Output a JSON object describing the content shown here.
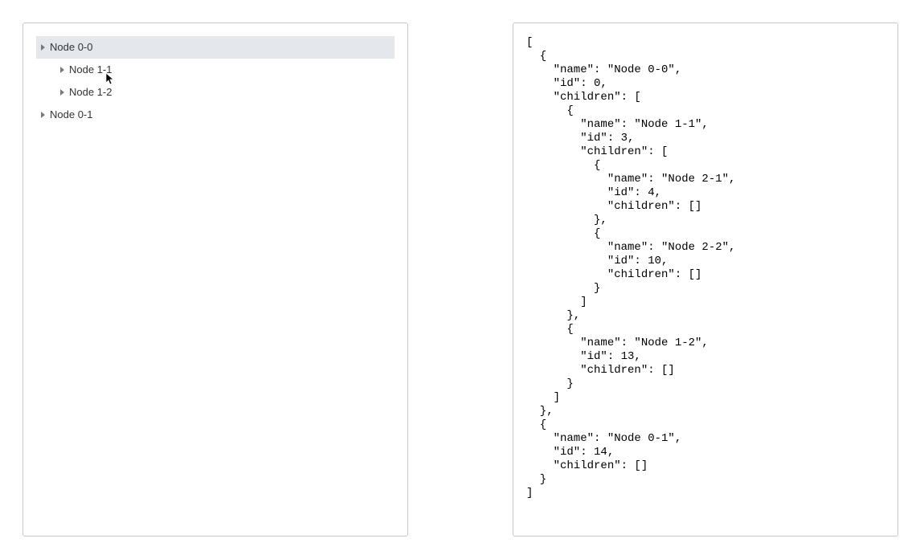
{
  "tree": {
    "nodes": [
      {
        "label": "Node 0-0",
        "indent": 0,
        "selected": true
      },
      {
        "label": "Node 1-1",
        "indent": 1,
        "selected": false
      },
      {
        "label": "Node 1-2",
        "indent": 1,
        "selected": false
      },
      {
        "label": "Node 0-1",
        "indent": 0,
        "selected": false
      }
    ]
  },
  "json_text": "[\n  {\n    \"name\": \"Node 0-0\",\n    \"id\": 0,\n    \"children\": [\n      {\n        \"name\": \"Node 1-1\",\n        \"id\": 3,\n        \"children\": [\n          {\n            \"name\": \"Node 2-1\",\n            \"id\": 4,\n            \"children\": []\n          },\n          {\n            \"name\": \"Node 2-2\",\n            \"id\": 10,\n            \"children\": []\n          }\n        ]\n      },\n      {\n        \"name\": \"Node 1-2\",\n        \"id\": 13,\n        \"children\": []\n      }\n    ]\n  },\n  {\n    \"name\": \"Node 0-1\",\n    \"id\": 14,\n    \"children\": []\n  }\n]"
}
